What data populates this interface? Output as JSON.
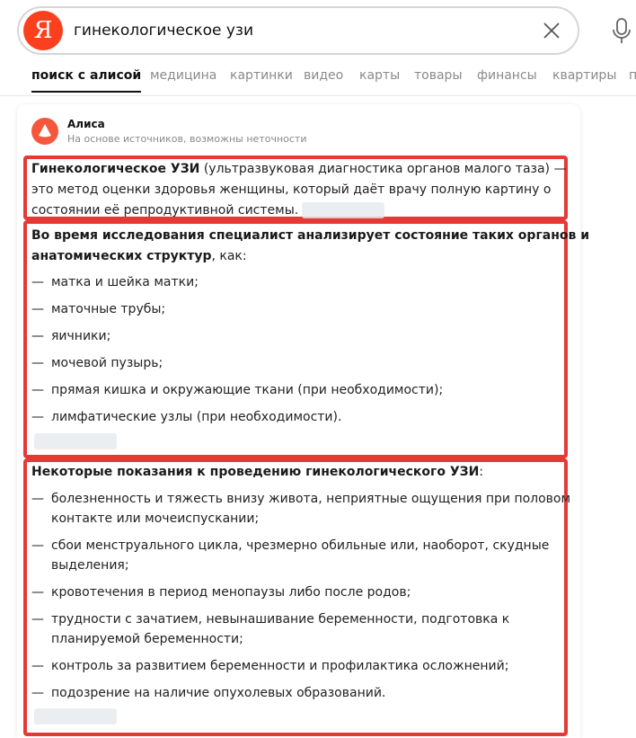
{
  "search": {
    "logo_letter": "Я",
    "query": "гинекологическое узи"
  },
  "tabs": [
    "поиск с алисой",
    "медицина",
    "картинки",
    "видео",
    "карты",
    "товары",
    "финансы",
    "квартиры",
    "п"
  ],
  "alice": {
    "name": "Алиса",
    "note": "На основе источников, возможны неточности"
  },
  "section1": {
    "bold": "Гинекологическое УЗИ",
    "line1_rest": " (ультразвуковая диагностика органов малого таза) —",
    "line2": "это метод оценки здоровья женщины, который даёт врачу полную картину о",
    "line3": "состоянии её репродуктивной системы."
  },
  "section2": {
    "bold_line1": "Во время исследования специалист анализирует состояние таких органов и",
    "bold_line2": "анатомических структур",
    "line2_rest": ", как:",
    "items": [
      "матка и шейка матки;",
      "маточные трубы;",
      "яичники;",
      "мочевой пузырь;",
      "прямая кишка и окружающие ткани (при необходимости);",
      "лимфатические узлы (при необходимости)."
    ]
  },
  "section3": {
    "bold": "Некоторые показания к проведению гинекологического УЗИ",
    "colon": ":",
    "items": [
      [
        "болезненность и тяжесть внизу живота, неприятные ощущения при половом",
        "контакте или мочеиспускании;"
      ],
      [
        "сбои менструального цикла, чрезмерно обильные или, наоборот, скудные",
        "выделения;"
      ],
      [
        "кровотечения в период менопаузы либо после родов;"
      ],
      [
        "трудности с зачатием, невынашивание беременности, подготовка к",
        "планируемой беременности;"
      ],
      [
        "контроль за развитием беременности и профилактика осложнений;"
      ],
      [
        "подозрение на наличие опухолевых образований."
      ]
    ]
  },
  "dash": "—",
  "colors": {
    "accent_red": "#e53935",
    "yandex_red": "#fc3f1d",
    "alice_orange": "#f4573b"
  }
}
